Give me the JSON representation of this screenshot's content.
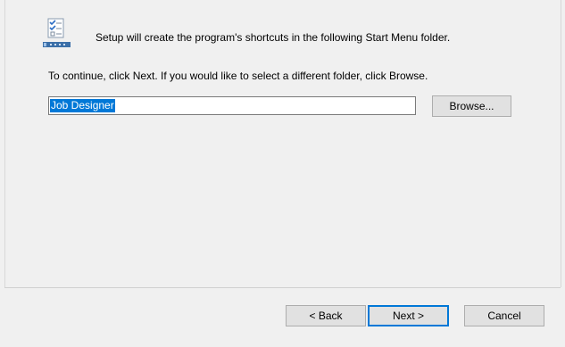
{
  "header": {
    "intro_text": "Setup will create the program's shortcuts in the following Start Menu folder.",
    "icon": "start-menu-folder-icon"
  },
  "main": {
    "instruction_text": "To continue, click Next. If you would like to select a different folder, click Browse.",
    "folder_input": {
      "value": "Job Designer",
      "selected": true
    },
    "browse_label": "Browse..."
  },
  "footer": {
    "back_label": "< Back",
    "next_label": "Next >",
    "cancel_label": "Cancel"
  },
  "colors": {
    "background": "#f0f0f0",
    "selection": "#0078d7",
    "button_face": "#e1e1e1",
    "button_border": "#adadad",
    "default_button_border": "#0078d7"
  }
}
